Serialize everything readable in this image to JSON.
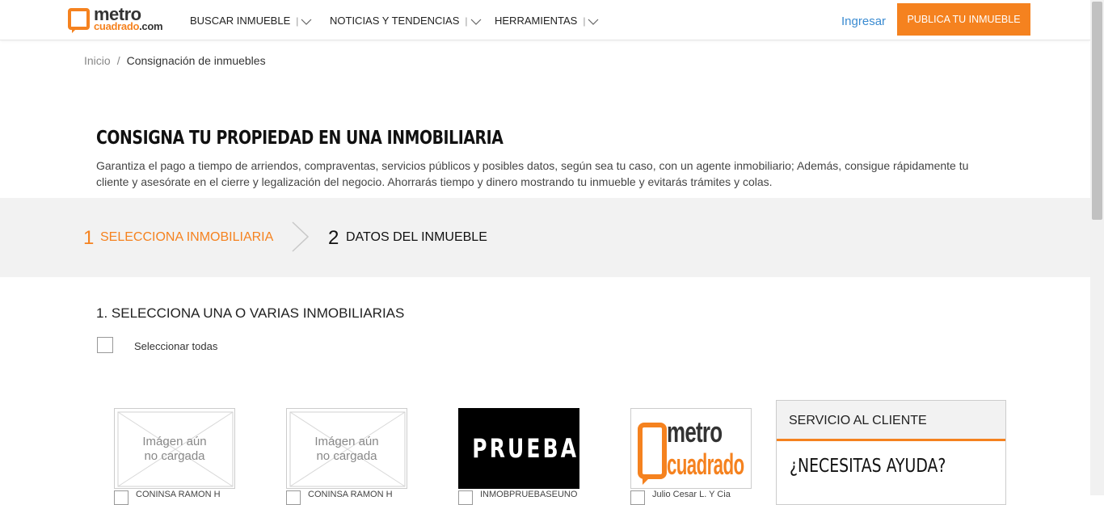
{
  "header": {
    "logo_top": "metro",
    "logo_bottom_main": "cuadrado",
    "logo_bottom_suffix": ".com",
    "nav": [
      {
        "label": "BUSCAR INMUEBLE"
      },
      {
        "label": "NOTICIAS Y TENDENCIAS"
      },
      {
        "label": "HERRAMIENTAS"
      }
    ],
    "nav_separator": "|",
    "login_label": "Ingresar",
    "publish_label": "PUBLICA TU INMUEBLE"
  },
  "breadcrumb": {
    "home": "Inicio",
    "separator": "/",
    "current": "Consignación de inmuebles"
  },
  "intro": {
    "title": "CONSIGNA TU PROPIEDAD EN UNA INMOBILIARIA",
    "description": "Garantiza el pago a tiempo de arriendos, compraventas, servicios públicos y posibles datos, según sea tu caso, con un agente inmobiliario; Además, consigue rápidamente tu cliente y asesórate en el cierre y legalización del negocio. Ahorrarás tiempo y dinero mostrando tu inmueble y evitarás trámites y colas."
  },
  "steps": [
    {
      "number": "1",
      "label": "SELECCIONA INMOBILIARIA",
      "active": true
    },
    {
      "number": "2",
      "label": "DATOS DEL INMUEBLE",
      "active": false
    }
  ],
  "section": {
    "title": "1. SELECCIONA UNA O VARIAS INMOBILIARIAS",
    "select_all_label": "Seleccionar todas"
  },
  "agencies": [
    {
      "image": "placeholder",
      "placeholder_line1": "Imágen aún",
      "placeholder_line2": "no cargada",
      "name": "CONINSA RAMON H"
    },
    {
      "image": "placeholder",
      "placeholder_line1": "Imágen aún",
      "placeholder_line2": "no cargada",
      "name": "CONINSA RAMON H"
    },
    {
      "image": "prueba",
      "logo_text": "PRUEBA",
      "name": "INMOBPRUEBASEUNO"
    },
    {
      "image": "metrocuadrado",
      "logo_top": "metro",
      "logo_bottom": "cuadrado",
      "name": "Julio Cesar L. Y Cia"
    }
  ],
  "help": {
    "header": "SERVICIO AL CLIENTE",
    "question": "¿NECESITAS AYUDA?"
  },
  "colors": {
    "accent": "#f5821f",
    "link": "#3a8bd1",
    "band": "#f2f2f2"
  }
}
